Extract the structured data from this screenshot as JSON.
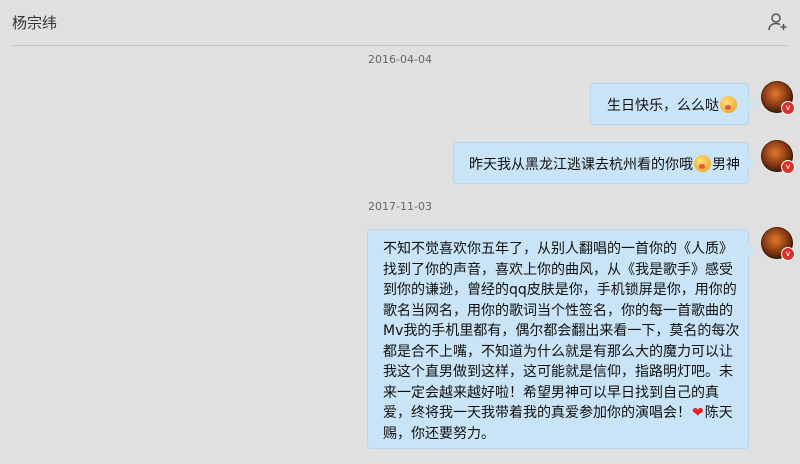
{
  "chat": {
    "contact_name": "杨宗纬",
    "add_friend_icon": "add-user-icon"
  },
  "messages": [
    {
      "date": "2016-04-04",
      "text": "生日快乐，么么哒",
      "emoji": "kiss-face-emoji"
    },
    {
      "text_before": "昨天我从黑龙江逃课去杭州看的你哦",
      "emoji": "kiss-face-emoji",
      "text_after": "男神"
    },
    {
      "date": "2017-11-03",
      "text_before": "不知不觉喜欢你五年了，从别人翻唱的一首你的《人质》\n找到了你的声音，喜欢上你的曲风，从《我是歌手》感受\n到你的谦逊，曾经的qq皮肤是你，手机锁屏是你，用你的\n歌名当网名，用你的歌词当个性签名，你的每一首歌曲的\nMv我的手机里都有，偶尔都会翻出来看一下，莫名的每次\n都是合不上嘴，不知道为什么就是有那么大的魔力可以让\n我这个直男做到这样，这可能就是信仰，指路明灯吧。未\n来一定会越来越好啦！希望男神可以早日找到自己的真\n爱，终将我一天我带着我的真爱参加你的演唱会！",
      "emoji": "red-heart-emoji",
      "text_after": "陈天\n赐，你还要努力。"
    }
  ],
  "avatar_badge": "v"
}
